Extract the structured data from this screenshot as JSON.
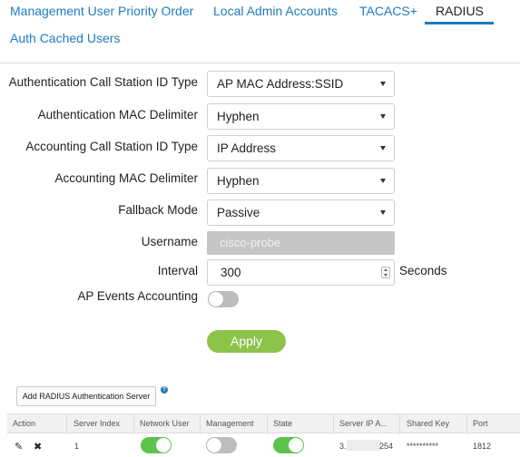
{
  "tabs": [
    {
      "label": "Management User Priority Order",
      "active": false
    },
    {
      "label": "Local Admin Accounts",
      "active": false
    },
    {
      "label": "TACACS+",
      "active": false
    },
    {
      "label": "RADIUS",
      "active": true
    },
    {
      "label": "Auth Cached Users",
      "active": false
    }
  ],
  "form": {
    "auth_call_station_id_type": {
      "label": "Authentication Call Station ID Type",
      "value": "AP MAC Address:SSID"
    },
    "auth_mac_delimiter": {
      "label": "Authentication MAC Delimiter",
      "value": "Hyphen"
    },
    "acct_call_station_id_type": {
      "label": "Accounting Call Station ID Type",
      "value": "IP Address"
    },
    "acct_mac_delimiter": {
      "label": "Accounting MAC Delimiter",
      "value": "Hyphen"
    },
    "fallback_mode": {
      "label": "Fallback Mode",
      "value": "Passive"
    },
    "username": {
      "label": "Username",
      "value": "cisco-probe"
    },
    "interval": {
      "label": "Interval",
      "value": "300",
      "unit": "Seconds"
    },
    "ap_events_accounting": {
      "label": "AP Events Accounting",
      "enabled": false
    },
    "apply_label": "Apply"
  },
  "add_server_button": "Add RADIUS Authentication Server",
  "help_glyph": "?",
  "table": {
    "headers": [
      "Action",
      "Server Index",
      "Network User",
      "Management",
      "State",
      "Server IP A...",
      "Shared Key",
      "Port"
    ],
    "rows": [
      {
        "server_index": "1",
        "network_user": true,
        "management": false,
        "state": true,
        "ip_prefix": "3.",
        "ip_suffix": "254",
        "shared_key": "**********",
        "port": "1812"
      }
    ]
  },
  "colors": {
    "accent": "#1f7bbf",
    "toggle_on": "#5cc34b",
    "apply": "#8cc44a"
  },
  "icons": [
    "edit-icon",
    "delete-icon",
    "help-icon",
    "dropdown-caret-icon",
    "spinner-icon"
  ]
}
